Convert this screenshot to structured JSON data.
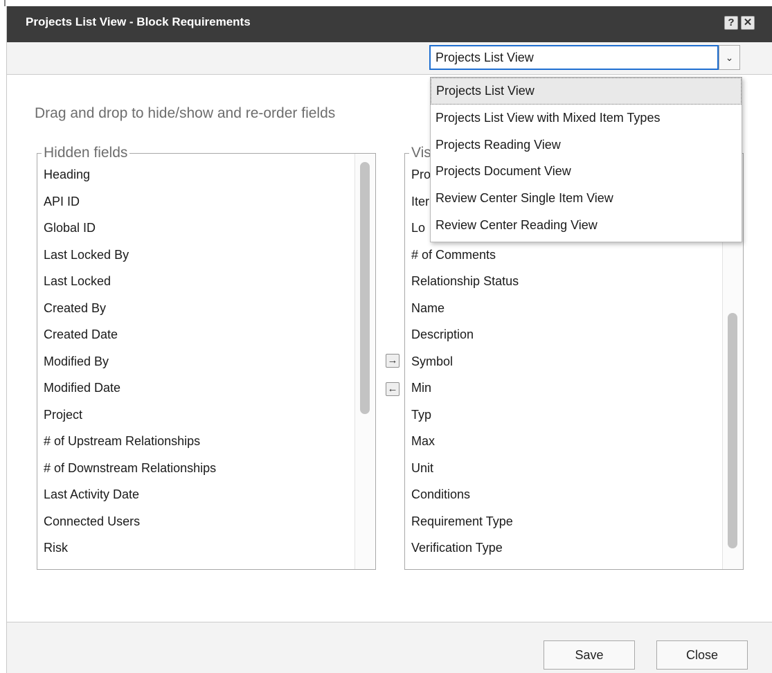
{
  "dialog": {
    "title": "Projects List View - Block Requirements",
    "help_icon_glyph": "?",
    "close_icon_glyph": "✕"
  },
  "view_selector": {
    "selected": "Projects List View",
    "arrow_glyph": "⌄",
    "options": [
      "Projects List View",
      "Projects List View with Mixed Item Types",
      "Projects Reading View",
      "Projects Document View",
      "Review Center Single Item View",
      "Review Center Reading View"
    ]
  },
  "instruction": "Drag and drop to hide/show and re-order fields",
  "hidden_fields": {
    "legend": "Hidden fields",
    "items": [
      "Heading",
      "API ID",
      "Global ID",
      "Last Locked By",
      "Last Locked",
      "Created By",
      "Created Date",
      "Modified By",
      "Modified Date",
      "Project",
      "# of Upstream Relationships",
      "# of Downstream Relationships",
      "Last Activity Date",
      "Connected Users",
      "Risk"
    ]
  },
  "visible_fields": {
    "legend": "Vis",
    "items": [
      "Pro",
      "Iter",
      "Lo",
      "# of Comments",
      "Relationship Status",
      "Name",
      "Description",
      "Symbol",
      "Min",
      "Typ",
      "Max",
      "Unit",
      "Conditions",
      "Requirement Type",
      "Verification Type"
    ]
  },
  "move_buttons": {
    "right_glyph": "→",
    "left_glyph": "←"
  },
  "footer": {
    "save_label": "Save",
    "close_label": "Close"
  },
  "colors": {
    "titlebar": "#3b3b3b",
    "focus_border": "#1f6fd1",
    "secondary_text": "#6d6d6d"
  }
}
